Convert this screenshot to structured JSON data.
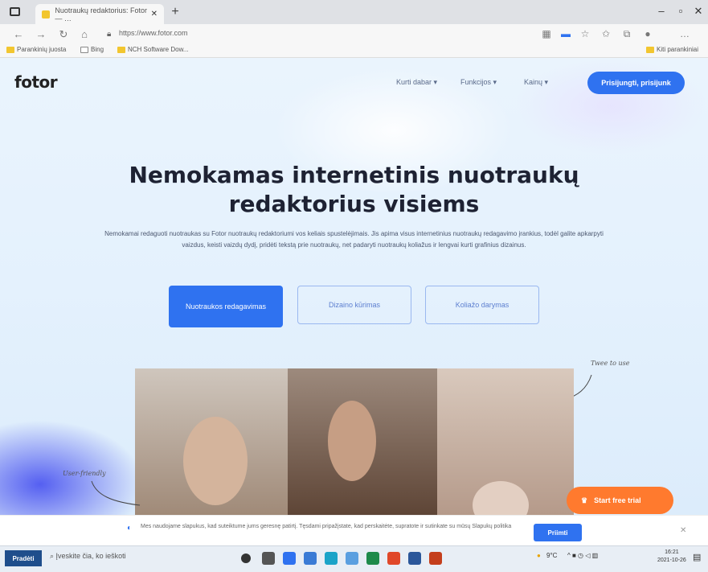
{
  "browser": {
    "tab_title": "Nuotraukų redaktorius: Fotor — …",
    "url": "https://www.fotor.com",
    "bookmarks": [
      "Parankinių juosta",
      "Bing",
      "NCH Software Dow..."
    ],
    "bookmarks_right": "Kiti parankiniai"
  },
  "header": {
    "logo": "fotor",
    "nav": [
      "Kurti dabar ▾",
      "Funkcijos ▾",
      "Kainų ▾"
    ],
    "login": "Prisijungti, prisijunk"
  },
  "hero": {
    "title_line1": "Nemokamas internetinis nuotraukų",
    "title_line2": "redaktorius visiems",
    "subtitle": "Nemokamai redaguoti nuotraukas su Fotor nuotraukų redaktoriumi vos keliais spustelėjimais. Jis apima visus internetinius nuotraukų redagavimo įrankius, todėl galite apkarpyti vaizdus, keisti vaizdų dydį, pridėti tekstą prie nuotraukų, net padaryti nuotraukų koliažus ir lengvai kurti grafinius dizainus.",
    "cta_primary": "Nuotraukos redagavimas",
    "cta_design": "Dizaino kūrimas",
    "cta_collage": "Koliažo darymas",
    "annotation_right": "Twee to use",
    "annotation_left": "User-friendly",
    "free_trial": "Start free trial"
  },
  "cookie": {
    "text": "Mes naudojame slapukus, kad suteiktume jums geresnę patirtį. Tęsdami pripažįstate, kad perskaitėte, supratote ir sutinkate su mūsų Slapukų politika",
    "accept": "Priimti"
  },
  "taskbar": {
    "start": "Pradėti",
    "search": "Įveskite čia, ko ieškoti",
    "tray_temp": "9°C",
    "time": "16:21",
    "date": "2021-10-26"
  },
  "colors": {
    "accent": "#2f72f0",
    "trial": "#ff7a2e"
  }
}
